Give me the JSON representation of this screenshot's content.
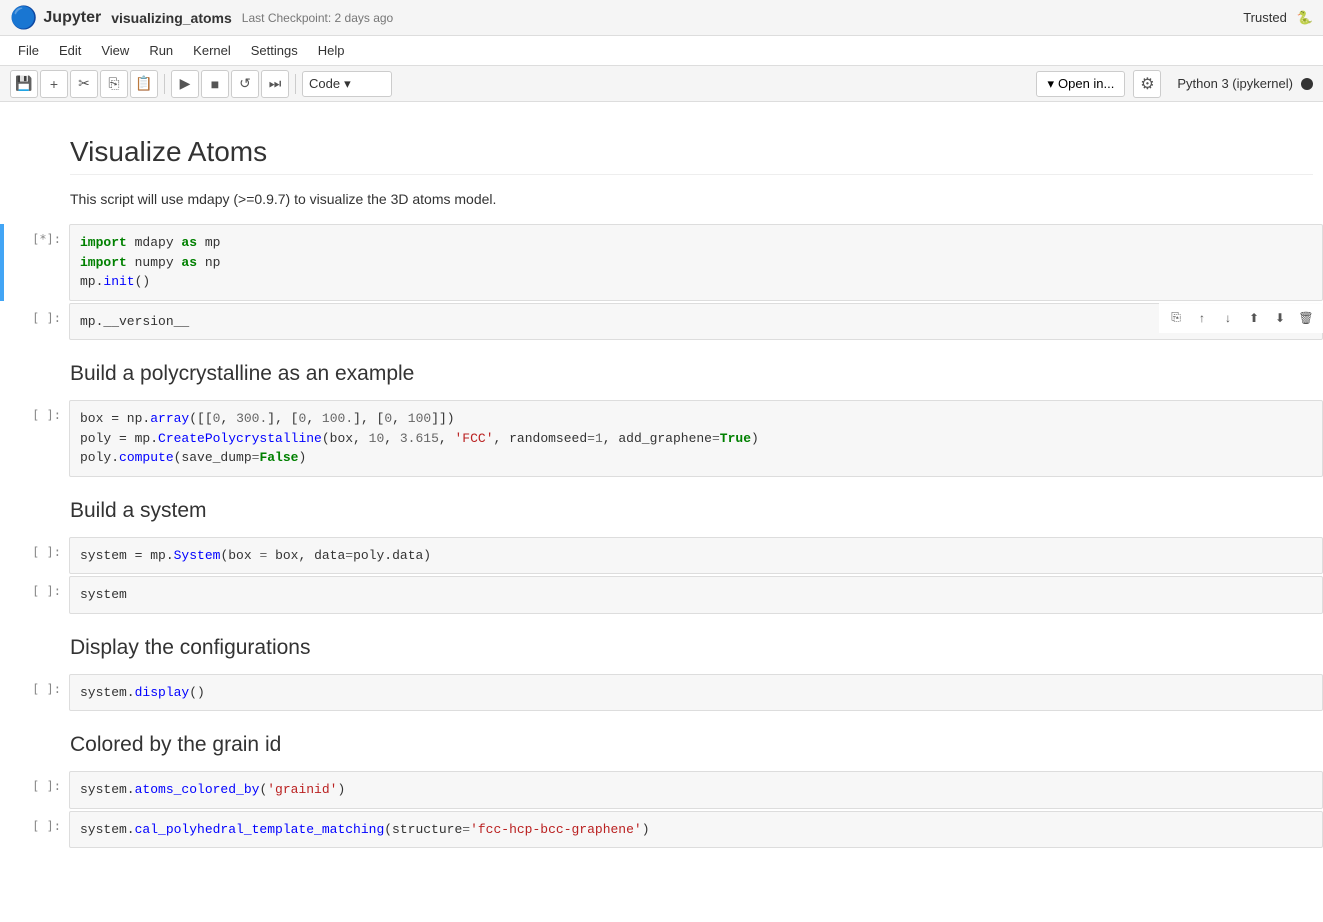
{
  "topbar": {
    "logo": "🔄",
    "app_name": "Jupyter",
    "notebook_name": "visualizing_atoms",
    "checkpoint_label": "Last Checkpoint: 2 days ago",
    "trusted": "Trusted"
  },
  "menubar": {
    "items": [
      "File",
      "Edit",
      "View",
      "Run",
      "Kernel",
      "Settings",
      "Help"
    ]
  },
  "toolbar": {
    "cell_type": "Code",
    "open_in": "Open in...",
    "kernel": "Python 3 (ipykernel)"
  },
  "notebook": {
    "title": "Visualize Atoms",
    "subtitle": "This script will use mdapy (>=0.9.7) to visualize the 3D atoms model.",
    "cells": [
      {
        "id": "cell-1",
        "type": "code",
        "prompt": "[*]:",
        "active": true,
        "code_lines": [
          {
            "text": "import mdapy as mp",
            "tokens": [
              {
                "t": "kw",
                "v": "import"
              },
              {
                "t": "plain",
                "v": " mdapy "
              },
              {
                "t": "kw",
                "v": "as"
              },
              {
                "t": "plain",
                "v": " mp"
              }
            ]
          },
          {
            "text": "import numpy as np",
            "tokens": [
              {
                "t": "kw",
                "v": "import"
              },
              {
                "t": "plain",
                "v": " numpy "
              },
              {
                "t": "kw",
                "v": "as"
              },
              {
                "t": "plain",
                "v": " np"
              }
            ]
          },
          {
            "text": "mp.init()",
            "tokens": [
              {
                "t": "plain",
                "v": "mp."
              },
              {
                "t": "func",
                "v": "init"
              },
              {
                "t": "plain",
                "v": "()"
              }
            ]
          }
        ]
      },
      {
        "id": "cell-2",
        "type": "code",
        "prompt": "[ ]:",
        "active": false,
        "show_actions": true,
        "code_lines": [
          {
            "text": "mp.__version__",
            "tokens": [
              {
                "t": "plain",
                "v": "mp.__version__"
              }
            ]
          }
        ]
      },
      {
        "id": "cell-3",
        "type": "markdown",
        "heading": "Build a polycrystalline as an example"
      },
      {
        "id": "cell-4",
        "type": "code",
        "prompt": "[ ]:",
        "active": false,
        "code_lines": [
          {
            "text": "box = np.array([[0, 300.], [0, 100.], [0, 100]])",
            "raw": "box = np.array([[0, 300.], [0, 100.], [0, 100]])"
          },
          {
            "text": "poly = mp.CreatePolycrystalline(box, 10, 3.615, 'FCC', randomseed=1, add_graphene=True)",
            "raw": "poly = mp.CreatePolycrystalline(box, 10, 3.615, 'FCC', randomseed=1, add_graphene=True)"
          },
          {
            "text": "poly.compute(save_dump=False)",
            "raw": "poly.compute(save_dump=False)"
          }
        ]
      },
      {
        "id": "cell-5",
        "type": "markdown",
        "heading": "Build a system"
      },
      {
        "id": "cell-6",
        "type": "code",
        "prompt": "[ ]:",
        "active": false,
        "code_lines": [
          {
            "text": "system = mp.System(box = box, data=poly.data)",
            "raw": "system = mp.System(box = box, data=poly.data)"
          }
        ]
      },
      {
        "id": "cell-7",
        "type": "code",
        "prompt": "[ ]:",
        "active": false,
        "code_lines": [
          {
            "text": "system",
            "raw": "system"
          }
        ]
      },
      {
        "id": "cell-8",
        "type": "markdown",
        "heading": "Display the configurations"
      },
      {
        "id": "cell-9",
        "type": "code",
        "prompt": "[ ]:",
        "active": false,
        "code_lines": [
          {
            "text": "system.display()",
            "raw": "system.display()"
          }
        ]
      },
      {
        "id": "cell-10",
        "type": "markdown",
        "heading": "Colored by the grain id"
      },
      {
        "id": "cell-11",
        "type": "code",
        "prompt": "[ ]:",
        "active": false,
        "code_lines": [
          {
            "text": "system.atoms_colored_by('grainid')",
            "raw": "system.atoms_colored_by('grainid')"
          }
        ]
      },
      {
        "id": "cell-12",
        "type": "code",
        "prompt": "[ ]:",
        "active": false,
        "code_lines": [
          {
            "text": "system.cal_polyhedral_template_matching(structure='fcc-hcp-bcc-graphene')",
            "raw": "system.cal_polyhedral_template_matching(structure='fcc-hcp-bcc-graphene')"
          }
        ]
      }
    ]
  }
}
